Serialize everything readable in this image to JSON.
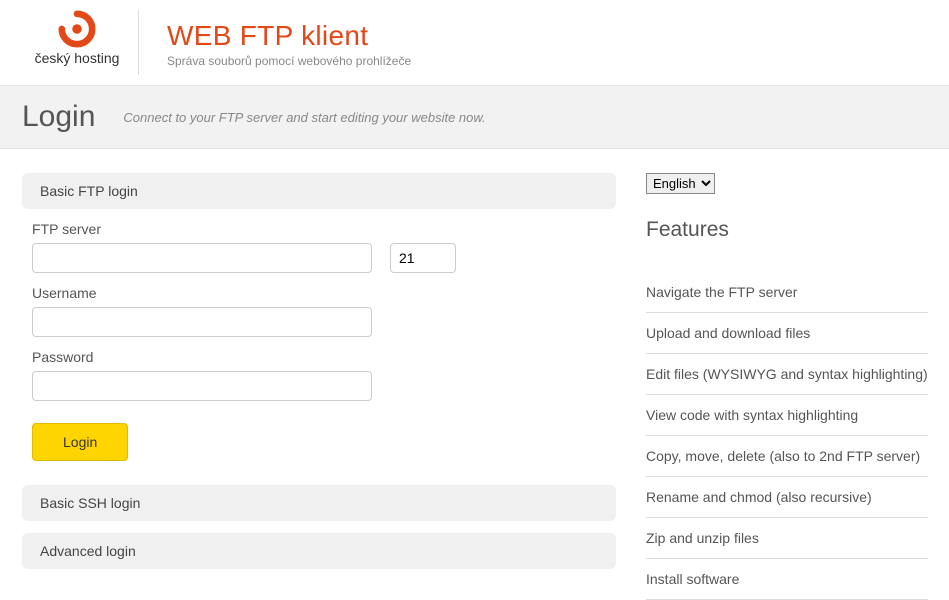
{
  "header": {
    "logo_text": "český hosting",
    "app_title": "WEB FTP klient",
    "app_subtitle": "Správa souborů pomocí webového prohlížeče"
  },
  "band": {
    "title": "Login",
    "tagline": "Connect to your FTP server and start editing your website now."
  },
  "sections": {
    "basic_ftp": "Basic FTP login",
    "basic_ssh": "Basic SSH login",
    "advanced": "Advanced login"
  },
  "form": {
    "server_label": "FTP server",
    "server_value": "",
    "port_value": "21",
    "username_label": "Username",
    "username_value": "",
    "password_label": "Password",
    "password_value": "",
    "login_button": "Login"
  },
  "sidebar": {
    "lang_selected": "English",
    "features_heading": "Features",
    "features": [
      "Navigate the FTP server",
      "Upload and download files",
      "Edit files (WYSIWYG and syntax highlighting)",
      "View code with syntax highlighting",
      "Copy, move, delete (also to 2nd FTP server)",
      "Rename and chmod (also recursive)",
      "Zip and unzip files",
      "Install software"
    ]
  }
}
